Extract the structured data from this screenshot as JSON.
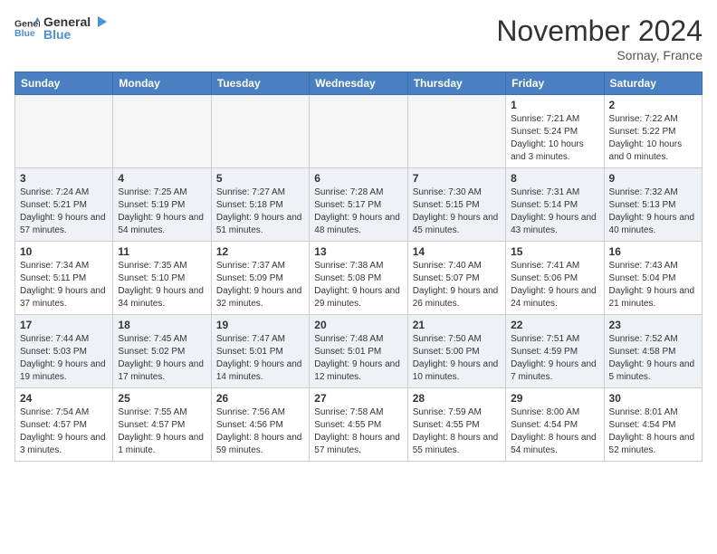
{
  "header": {
    "logo": {
      "general": "General",
      "blue": "Blue"
    },
    "month": "November 2024",
    "location": "Sornay, France"
  },
  "weekdays": [
    "Sunday",
    "Monday",
    "Tuesday",
    "Wednesday",
    "Thursday",
    "Friday",
    "Saturday"
  ],
  "weeks": [
    [
      {
        "day": null,
        "empty": true
      },
      {
        "day": null,
        "empty": true
      },
      {
        "day": null,
        "empty": true
      },
      {
        "day": null,
        "empty": true
      },
      {
        "day": null,
        "empty": true
      },
      {
        "day": 1,
        "sunrise": "7:21 AM",
        "sunset": "5:24 PM",
        "daylight": "10 hours and 3 minutes."
      },
      {
        "day": 2,
        "sunrise": "7:22 AM",
        "sunset": "5:22 PM",
        "daylight": "10 hours and 0 minutes."
      }
    ],
    [
      {
        "day": 3,
        "sunrise": "7:24 AM",
        "sunset": "5:21 PM",
        "daylight": "9 hours and 57 minutes."
      },
      {
        "day": 4,
        "sunrise": "7:25 AM",
        "sunset": "5:19 PM",
        "daylight": "9 hours and 54 minutes."
      },
      {
        "day": 5,
        "sunrise": "7:27 AM",
        "sunset": "5:18 PM",
        "daylight": "9 hours and 51 minutes."
      },
      {
        "day": 6,
        "sunrise": "7:28 AM",
        "sunset": "5:17 PM",
        "daylight": "9 hours and 48 minutes."
      },
      {
        "day": 7,
        "sunrise": "7:30 AM",
        "sunset": "5:15 PM",
        "daylight": "9 hours and 45 minutes."
      },
      {
        "day": 8,
        "sunrise": "7:31 AM",
        "sunset": "5:14 PM",
        "daylight": "9 hours and 43 minutes."
      },
      {
        "day": 9,
        "sunrise": "7:32 AM",
        "sunset": "5:13 PM",
        "daylight": "9 hours and 40 minutes."
      }
    ],
    [
      {
        "day": 10,
        "sunrise": "7:34 AM",
        "sunset": "5:11 PM",
        "daylight": "9 hours and 37 minutes."
      },
      {
        "day": 11,
        "sunrise": "7:35 AM",
        "sunset": "5:10 PM",
        "daylight": "9 hours and 34 minutes."
      },
      {
        "day": 12,
        "sunrise": "7:37 AM",
        "sunset": "5:09 PM",
        "daylight": "9 hours and 32 minutes."
      },
      {
        "day": 13,
        "sunrise": "7:38 AM",
        "sunset": "5:08 PM",
        "daylight": "9 hours and 29 minutes."
      },
      {
        "day": 14,
        "sunrise": "7:40 AM",
        "sunset": "5:07 PM",
        "daylight": "9 hours and 26 minutes."
      },
      {
        "day": 15,
        "sunrise": "7:41 AM",
        "sunset": "5:06 PM",
        "daylight": "9 hours and 24 minutes."
      },
      {
        "day": 16,
        "sunrise": "7:43 AM",
        "sunset": "5:04 PM",
        "daylight": "9 hours and 21 minutes."
      }
    ],
    [
      {
        "day": 17,
        "sunrise": "7:44 AM",
        "sunset": "5:03 PM",
        "daylight": "9 hours and 19 minutes."
      },
      {
        "day": 18,
        "sunrise": "7:45 AM",
        "sunset": "5:02 PM",
        "daylight": "9 hours and 17 minutes."
      },
      {
        "day": 19,
        "sunrise": "7:47 AM",
        "sunset": "5:01 PM",
        "daylight": "9 hours and 14 minutes."
      },
      {
        "day": 20,
        "sunrise": "7:48 AM",
        "sunset": "5:01 PM",
        "daylight": "9 hours and 12 minutes."
      },
      {
        "day": 21,
        "sunrise": "7:50 AM",
        "sunset": "5:00 PM",
        "daylight": "9 hours and 10 minutes."
      },
      {
        "day": 22,
        "sunrise": "7:51 AM",
        "sunset": "4:59 PM",
        "daylight": "9 hours and 7 minutes."
      },
      {
        "day": 23,
        "sunrise": "7:52 AM",
        "sunset": "4:58 PM",
        "daylight": "9 hours and 5 minutes."
      }
    ],
    [
      {
        "day": 24,
        "sunrise": "7:54 AM",
        "sunset": "4:57 PM",
        "daylight": "9 hours and 3 minutes."
      },
      {
        "day": 25,
        "sunrise": "7:55 AM",
        "sunset": "4:57 PM",
        "daylight": "9 hours and 1 minute."
      },
      {
        "day": 26,
        "sunrise": "7:56 AM",
        "sunset": "4:56 PM",
        "daylight": "8 hours and 59 minutes."
      },
      {
        "day": 27,
        "sunrise": "7:58 AM",
        "sunset": "4:55 PM",
        "daylight": "8 hours and 57 minutes."
      },
      {
        "day": 28,
        "sunrise": "7:59 AM",
        "sunset": "4:55 PM",
        "daylight": "8 hours and 55 minutes."
      },
      {
        "day": 29,
        "sunrise": "8:00 AM",
        "sunset": "4:54 PM",
        "daylight": "8 hours and 54 minutes."
      },
      {
        "day": 30,
        "sunrise": "8:01 AM",
        "sunset": "4:54 PM",
        "daylight": "8 hours and 52 minutes."
      }
    ]
  ]
}
